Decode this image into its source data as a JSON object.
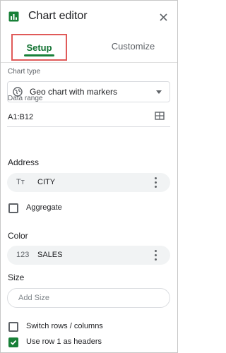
{
  "header": {
    "title": "Chart editor",
    "close_icon": "close-icon",
    "app_icon": "chart-editor-icon"
  },
  "tabs": [
    {
      "label": "Setup",
      "active": true
    },
    {
      "label": "Customize",
      "active": false
    }
  ],
  "chart_type": {
    "label": "Chart type",
    "value": "Geo chart with markers",
    "icon": "globe-icon"
  },
  "data_range": {
    "label": "Data range",
    "value": "A1:B12",
    "icon": "grid-icon"
  },
  "address": {
    "label": "Address",
    "chip": {
      "icon_text": "Tт",
      "value": "CITY"
    }
  },
  "aggregate": {
    "label": "Aggregate",
    "checked": false
  },
  "color": {
    "label": "Color",
    "chip": {
      "icon_text": "123",
      "value": "SALES"
    }
  },
  "size": {
    "label": "Size",
    "placeholder": "Add Size"
  },
  "options": [
    {
      "label": "Switch rows / columns",
      "checked": false
    },
    {
      "label": "Use row 1 as headers",
      "checked": true
    }
  ],
  "colors": {
    "accent": "#188038",
    "highlight_border": "#e05a59",
    "chip_bg": "#f1f3f4"
  }
}
